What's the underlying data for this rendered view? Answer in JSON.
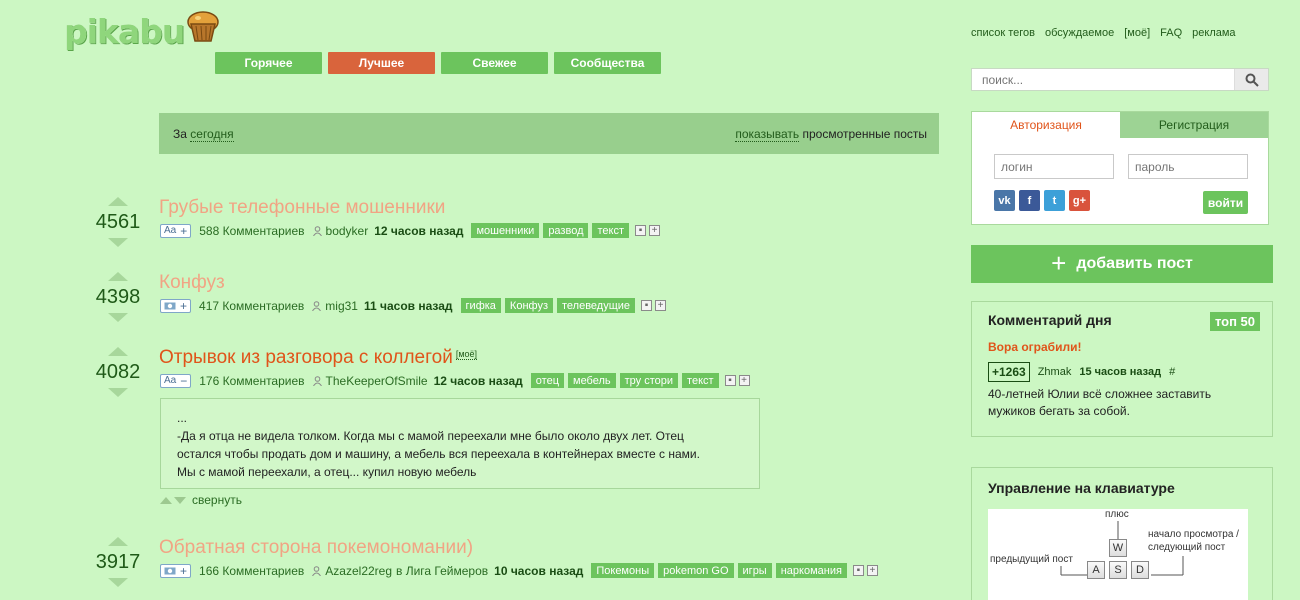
{
  "logo": {
    "text": "pikabu"
  },
  "toplinks": [
    "список тегов",
    "обсуждаемое",
    "[моё]",
    "FAQ",
    "реклама"
  ],
  "nav": {
    "tabs": [
      "Горячее",
      "Лучшее",
      "Свежее",
      "Сообщества"
    ],
    "active": "Лучшее"
  },
  "search": {
    "placeholder": "поиск..."
  },
  "filter": {
    "prefix": "За",
    "period": "сегодня",
    "show": "показывать",
    "suffix": "просмотренные посты"
  },
  "posts": [
    {
      "rating": "4561",
      "title": "Грубые телефонные мошенники",
      "badge": "Aa",
      "comments": "588 Комментариев",
      "author": "bodyker",
      "time": "12 часов назад",
      "tags": [
        "мошенники",
        "развод",
        "текст"
      ],
      "seen": true
    },
    {
      "rating": "4398",
      "title": "Конфуз",
      "badge": "camera",
      "comments": "417 Комментариев",
      "author": "mig31",
      "time": "11 часов назад",
      "tags": [
        "гифка",
        "Конфуз",
        "телеведущие"
      ],
      "seen": true
    },
    {
      "rating": "4082",
      "title": "Отрывок из разговора с коллегой",
      "moe": "[моё]",
      "badge": "Aa",
      "comments": "176 Комментариев",
      "author": "TheKeeperOfSmile",
      "time": "12 часов назад",
      "tags": [
        "отец",
        "мебель",
        "тру стори",
        "текст"
      ],
      "seen": false,
      "text": [
        "...",
        "-Да я отца не видела толком. Когда мы с мамой переехали мне было около двух лет. Отец",
        "остался чтобы продать дом и машину, а мебель вся переехала в контейнерах вместе с нами.",
        "Мы с мамой переехали, а отец... купил новую мебель"
      ],
      "collapse": "свернуть"
    },
    {
      "rating": "3917",
      "title": "Обратная сторона покемономании)",
      "badge": "camera",
      "comments": "166 Комментариев",
      "author": "Azazel22reg",
      "community": "в Лига Геймеров",
      "time": "10 часов назад",
      "tags": [
        "Покемоны",
        "pokemon GO",
        "игры",
        "наркомания"
      ],
      "seen": true
    }
  ],
  "auth": {
    "tab_login": "Авторизация",
    "tab_register": "Регистрация",
    "login_placeholder": "логин",
    "password_placeholder": "пароль",
    "submit": "войти",
    "socials": [
      "vk",
      "facebook",
      "twitter",
      "google-plus"
    ]
  },
  "add_post": "добавить пост",
  "comment_of_day": {
    "title": "Комментарий дня",
    "top": "топ 50",
    "post": "Вора ограбили!",
    "score": "+1263",
    "author": "Zhmak",
    "time": "15 часов назад",
    "hash": "#",
    "text": [
      "40-летней Юлии всё сложнее заставить",
      "мужиков бегать за собой."
    ]
  },
  "keyboard": {
    "title": "Управление на клавиатуре",
    "plus": "плюс",
    "prev": "предыдущий пост",
    "next": [
      "начало просмотра /",
      "следующий пост"
    ],
    "keys": [
      "W",
      "A",
      "S",
      "D"
    ]
  },
  "colors": {
    "background": "#ccf7c3",
    "accent": "#6cc45d",
    "active_tab": "#d9643c",
    "title_unseen": "#e0541a",
    "title_seen": "#f1a484"
  }
}
